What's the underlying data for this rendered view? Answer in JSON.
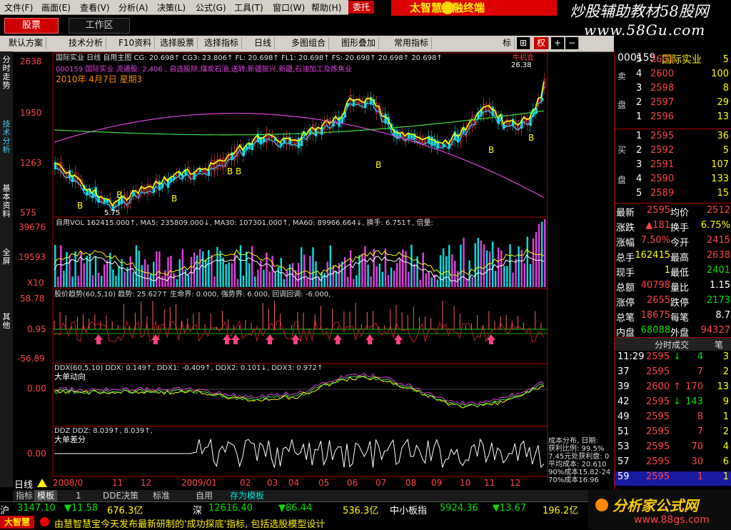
{
  "menubar": {
    "items": [
      "文件(F)",
      "画面(E)",
      "查看(V)",
      "分析(A)",
      "决策(L)",
      "公式(G)",
      "工具(T)",
      "窗口(W)",
      "帮助(H)"
    ]
  },
  "banner": {
    "trust": "委托",
    "title": "太智慧金融终端",
    "watermark": "炒股辅助教材58股网",
    "watermark_url": "www.58Gu.com"
  },
  "bar2": {
    "stock_tab": "股票",
    "workspace_tab": "工作区"
  },
  "toolbar": {
    "items": [
      "默认方案",
      "技术分析",
      "F10资料",
      "选择股票",
      "选择指标",
      "日线",
      "多图组合",
      "图形叠加",
      "常用指标",
      "标",
      "权"
    ]
  },
  "lefttabs": [
    "分时走势",
    "技术分析",
    "基本资料",
    "全屏",
    "其他"
  ],
  "chart": {
    "main": {
      "header1": "国际实业 日线 自用主图 CG: 20.698↑ CG3: 23.806↑ FL: 20.698↑ FL1: 20.698↑ FS: 20.698↑ 20.698↑ 20.698↑",
      "header1_tag": "牛机会",
      "header2": "000159 国际实业 流通股: 2.406 , 自选股除,煤炭石油,送转,新疆振兴,新疆,石油加工及炼焦业",
      "date": "2010年 4月7日 星期3",
      "price_top": "26.38",
      "low_label": "5.75",
      "yaxis": [
        "2638",
        "1950",
        "1263",
        "575"
      ]
    },
    "vol": {
      "header": "自用VOL 162415.000↑, MA5: 235809.000↓, MA30: 107301.000↑, MA60: 89966.664↓, 换手: 6.751↑, 倍量:",
      "yaxis": [
        "39676",
        "19593",
        "X10"
      ]
    },
    "trend": {
      "header": "股价趋势(60,5,10) 趋势: 25.627↑ 生命界: 0.000, 强势界: 6.000, 回调回调: -6.000,",
      "yaxis": [
        "58.78",
        "0.95",
        "-56.89"
      ]
    },
    "ddx": {
      "header": "DDX(60,5,10) DDX: 0.149↑, DDX1: -0.409↑, DDX2: 0.101↓, DDX3: 0.972↑",
      "subtitle": "大单动向",
      "yaxis": [
        "0.00"
      ]
    },
    "ddz": {
      "header": "DDZ DDZ: 8.039↑, 8.039↑,",
      "subtitle": "大单差分",
      "yaxis": [
        "0.00"
      ]
    },
    "cost": {
      "lines": [
        "成本分布, 日期:",
        "获利比例: 99.5%",
        "7.45元处获利盘: 0",
        "平均成本: 20.610",
        "90%成本15.82-24",
        "70%成本16.96"
      ]
    }
  },
  "datebar": {
    "label": "日线",
    "dates": [
      "2008/0",
      "11",
      "12",
      "2009/01",
      "02",
      "03",
      "04",
      "05",
      "06",
      "07",
      "08",
      "09",
      "10",
      "11",
      "12"
    ]
  },
  "tabbar": {
    "items": [
      "指标",
      "模板",
      "1",
      "DDE决策",
      "标准",
      "自用",
      "存为模板"
    ]
  },
  "rightpanel": {
    "code": "000159",
    "name": "国际实业",
    "sell_label": [
      "卖",
      "盘"
    ],
    "buy_label": [
      "买",
      "盘"
    ],
    "sells": [
      {
        "n": "5",
        "p": "2601",
        "v": "5"
      },
      {
        "n": "4",
        "p": "2600",
        "v": "100"
      },
      {
        "n": "3",
        "p": "2598",
        "v": "8"
      },
      {
        "n": "2",
        "p": "2597",
        "v": "29"
      },
      {
        "n": "1",
        "p": "2596",
        "v": "13"
      }
    ],
    "buys": [
      {
        "n": "1",
        "p": "2595",
        "v": "36"
      },
      {
        "n": "2",
        "p": "2592",
        "v": "5"
      },
      {
        "n": "3",
        "p": "2591",
        "v": "107"
      },
      {
        "n": "4",
        "p": "2590",
        "v": "133"
      },
      {
        "n": "5",
        "p": "2589",
        "v": "15"
      }
    ],
    "stats": [
      {
        "l1": "最新",
        "v1": "2595",
        "l2": "均价",
        "v2": "2512"
      },
      {
        "l1": "涨跌",
        "v1": "▲181",
        "l2": "换手",
        "v2": "6.75%"
      },
      {
        "l1": "涨幅",
        "v1": "7.50%",
        "l2": "今开",
        "v2": "2415"
      },
      {
        "l1": "总手",
        "v1": "162415",
        "l2": "最高",
        "v2": "2638"
      },
      {
        "l1": "现手",
        "v1": "1",
        "l2": "最低",
        "v2": "2401"
      },
      {
        "l1": "总额",
        "v1": "40798",
        "l2": "量比",
        "v2": "1.15"
      },
      {
        "l1": "涨停",
        "v1": "2655",
        "l2": "跌停",
        "v2": "2173"
      },
      {
        "l1": "总笔",
        "v1": "18675",
        "l2": "每笔",
        "v2": "8.7"
      },
      {
        "l1": "内盘",
        "v1": "68088",
        "l2": "外盘",
        "v2": "94327"
      }
    ],
    "ticks_title": "分时成交",
    "ticks_btn": "笔",
    "ticks": [
      {
        "t": "11:29",
        "p": "2595",
        "d": "down",
        "v": "4",
        "n": "3"
      },
      {
        "t": "37",
        "p": "2595",
        "d": "",
        "v": "7",
        "n": "2"
      },
      {
        "t": "39",
        "p": "2600",
        "d": "up",
        "v": "170",
        "n": "13"
      },
      {
        "t": "42",
        "p": "2595",
        "d": "down",
        "v": "143",
        "n": "9"
      },
      {
        "t": "49",
        "p": "2595",
        "d": "",
        "v": "8",
        "n": "1"
      },
      {
        "t": "51",
        "p": "2595",
        "d": "",
        "v": "7",
        "n": "2"
      },
      {
        "t": "53",
        "p": "2595",
        "d": "",
        "v": "70",
        "n": "4"
      },
      {
        "t": "57",
        "p": "2595",
        "d": "",
        "v": "30",
        "n": "6"
      },
      {
        "t": "59",
        "p": "2595",
        "d": "",
        "v": "1",
        "n": "1"
      }
    ]
  },
  "indexbar": {
    "items": [
      {
        "label": "沪",
        "val": "3147.10",
        "chg": "▼11.58",
        "amt": "676.3亿"
      },
      {
        "label": "深",
        "val": "12616.40",
        "chg": "▼86.44",
        "amt": "536.3亿"
      },
      {
        "label": "中小板指",
        "val": "5924.36",
        "chg": "▼13.67",
        "amt": "196.2亿"
      }
    ]
  },
  "newsbar": {
    "logo": "大智慧",
    "text": "由慧智慧宝今天发布最新研制的'成功探底'指标, 包括选股模型设计"
  },
  "logo2": {
    "text": "分析家公式网",
    "url": "www.88gs.com"
  }
}
